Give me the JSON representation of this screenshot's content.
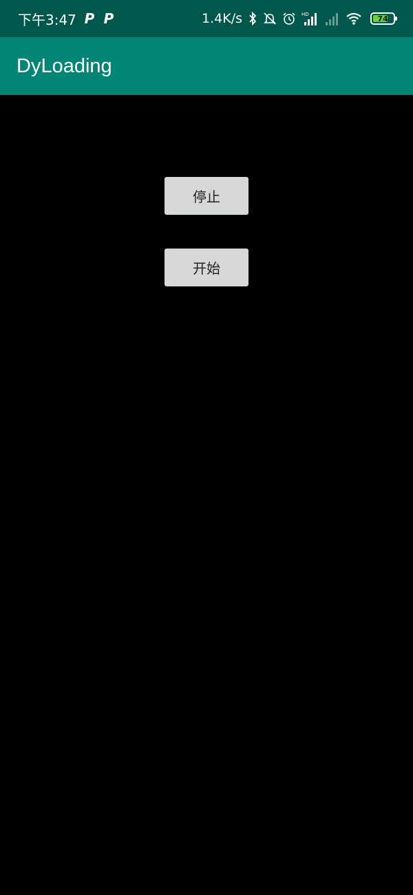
{
  "status_bar": {
    "time": "下午3:47",
    "notification_icons": [
      "P",
      "P"
    ],
    "network_speed": "1.4K/s",
    "icons": [
      "bluetooth-icon",
      "mute-icon",
      "alarm-icon",
      "signal-hd-icon",
      "signal-weak-icon",
      "wifi-icon"
    ],
    "hd_label": "HD",
    "battery_level": "74",
    "battery_fraction": 0.74,
    "battery_color": "#6BD13A"
  },
  "app_bar": {
    "title": "DyLoading",
    "color": "#008577"
  },
  "buttons": {
    "stop_label": "停止",
    "start_label": "开始"
  },
  "colors": {
    "status_bar": "#00574B",
    "background": "#000000",
    "button": "#D6D7D7"
  }
}
